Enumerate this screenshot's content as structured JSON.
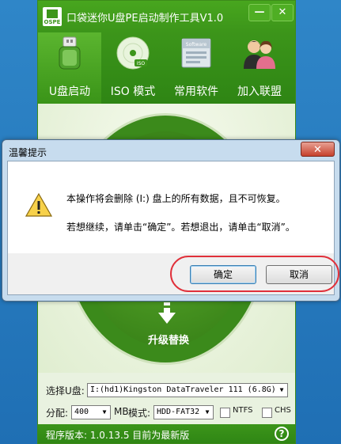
{
  "app": {
    "logo_text": "OSPE",
    "title": "口袋迷你U盘PE启动制作工具V1.0",
    "min_symbol": "—",
    "close_symbol": "✕",
    "tabs": [
      {
        "label": "U盘启动",
        "active": true,
        "icon": "usb-drive-icon"
      },
      {
        "label": "ISO 模式",
        "active": false,
        "icon": "disc-icon"
      },
      {
        "label": "常用软件",
        "active": false,
        "icon": "software-box-icon"
      },
      {
        "label": "加入联盟",
        "active": false,
        "icon": "people-icon"
      }
    ],
    "iso_badge": "ISO",
    "software_badge": "Software",
    "upgrade_label": "升级替换",
    "select_usb_label": "选择U盘:",
    "select_usb_value": "I:(hd1)Kingston DataTraveler 111 (6.8G)",
    "alloc_label": "分配:",
    "alloc_value": "400",
    "alloc_unit": "MB",
    "mode_label": "模式:",
    "mode_value": "HDD-FAT32",
    "ntfs_label": "NTFS",
    "chs_label": "CHS",
    "status_text": "程序版本: 1.0.13.5  目前为最新版",
    "help_symbol": "?"
  },
  "dialog": {
    "title": "温馨提示",
    "close_symbol": "✕",
    "message_line1": "本操作将会删除 (I:) 盘上的所有数据，且不可恢复。",
    "message_line2": "若想继续，请单击“确定”。若想退出，请单击“取消”。",
    "ok_label": "确定",
    "cancel_label": "取消"
  },
  "colors": {
    "app_green": "#3c951a",
    "desktop_blue": "#2f86c8",
    "highlight_red": "#e0303a"
  }
}
